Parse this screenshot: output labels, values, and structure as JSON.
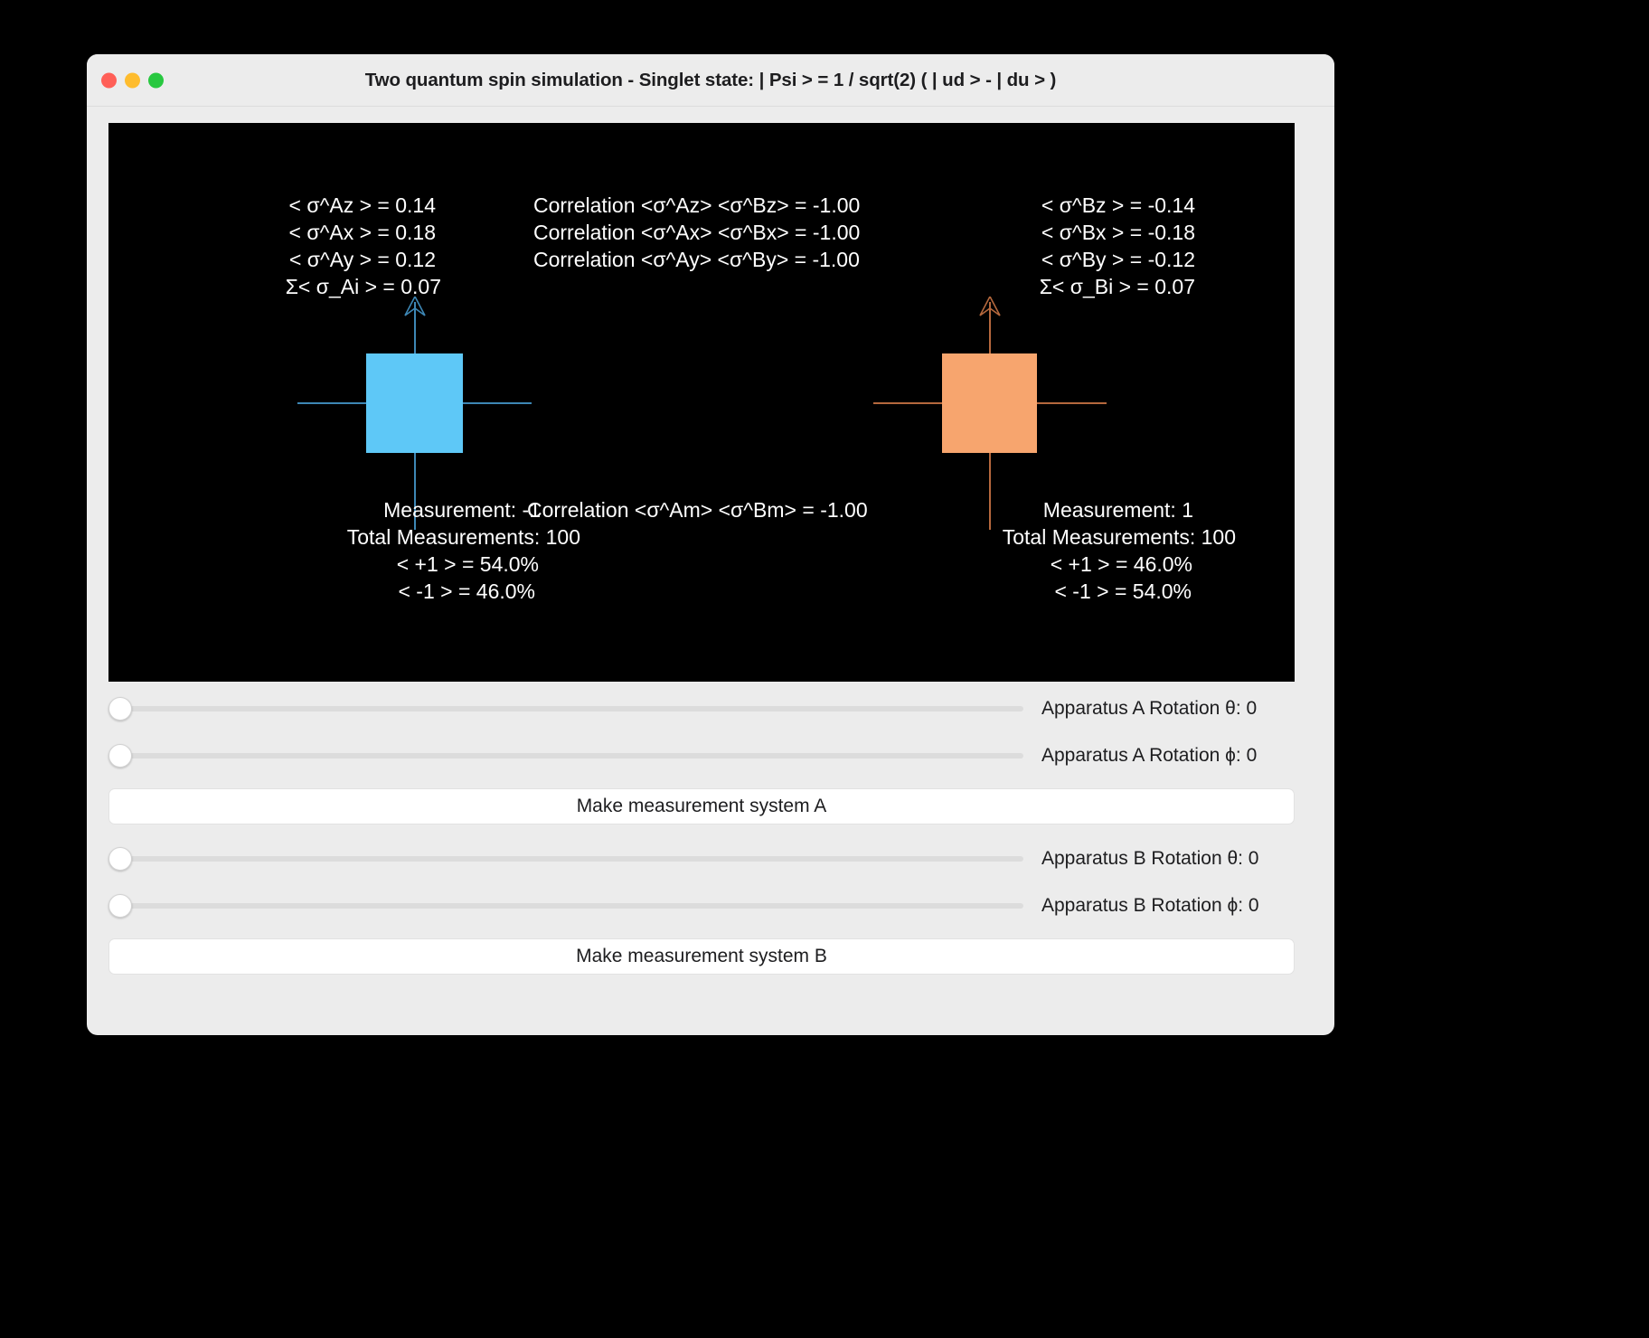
{
  "window": {
    "title": "Two quantum spin simulation - Singlet state: | Psi > = 1 / sqrt(2) ( | ud > - | du > )",
    "traffic_lights": {
      "close": "close",
      "minimize": "minimize",
      "zoom": "zoom"
    }
  },
  "canvas": {
    "system_a": {
      "expectations": [
        "< σ^Az > = 0.14",
        "< σ^Ax > = 0.18",
        "< σ^Ay > = 0.12",
        "Σ< σ_Ai > = 0.07"
      ],
      "measurement": "Measurement: -1",
      "total": "Total Measurements: 100",
      "plus_pct": "< +1 > = 54.0%",
      "minus_pct": "< -1 > = 46.0%",
      "color": "#5ec8f7",
      "axis_color": "#3d87b5"
    },
    "system_b": {
      "expectations": [
        "< σ^Bz > = -0.14",
        "< σ^Bx > = -0.18",
        "< σ^By > = -0.12",
        "Σ< σ_Bi > = 0.07"
      ],
      "measurement": "Measurement: 1",
      "total": "Total Measurements: 100",
      "plus_pct": "< +1 > = 46.0%",
      "minus_pct": "< -1 > = 54.0%",
      "color": "#f7a56e",
      "axis_color": "#b5683d"
    },
    "correlations": [
      "Correlation <σ^Az> <σ^Bz> = -1.00",
      "Correlation <σ^Ax> <σ^Bx> = -1.00",
      "Correlation <σ^Ay> <σ^By> = -1.00"
    ],
    "measurement_correlation": "Correlation <σ^Am> <σ^Bm> = -1.00",
    "background": "#000000",
    "text_color": "#ffffff"
  },
  "controls": {
    "a_theta": {
      "label": "Apparatus A Rotation θ: 0",
      "value": 0
    },
    "a_phi": {
      "label": "Apparatus A Rotation ϕ: 0",
      "value": 0
    },
    "btn_a": "Make measurement system A",
    "b_theta": {
      "label": "Apparatus B Rotation θ: 0",
      "value": 0
    },
    "b_phi": {
      "label": "Apparatus B Rotation ϕ: 0",
      "value": 0
    },
    "btn_b": "Make measurement system B"
  }
}
